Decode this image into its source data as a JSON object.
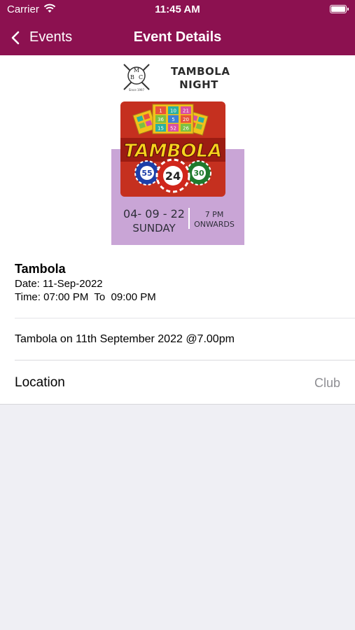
{
  "status_bar": {
    "carrier": "Carrier",
    "time": "11:45 AM"
  },
  "nav": {
    "back_label": "Events",
    "title": "Event Details"
  },
  "poster": {
    "logo_letters": [
      "M",
      "B",
      "C"
    ],
    "logo_caption": "Since 1997",
    "heading_line1": "TAMBOLA",
    "heading_line2": "NIGHT",
    "game_title": "TAMBOLA",
    "ticket_numbers": [
      "1",
      "10",
      "21",
      "36",
      "5",
      "20",
      "15",
      "52",
      "26"
    ],
    "chip_numbers": [
      "55",
      "24",
      "30"
    ],
    "date": "04- 09 - 22",
    "day": "SUNDAY",
    "time_line1": "7 PM",
    "time_line2": "ONWARDS"
  },
  "event": {
    "name": "Tambola",
    "date_text": "Date: 11-Sep-2022",
    "time_text": "Time: 07:00 PM  To  09:00 PM",
    "description": "Tambola on 11th September 2022 @7.00pm"
  },
  "location": {
    "label": "Location",
    "value": "Club"
  },
  "colors": {
    "nav_background": "#8c1150",
    "poster_accent": "#c9a5d6",
    "secondary_text": "#8e8e93"
  }
}
